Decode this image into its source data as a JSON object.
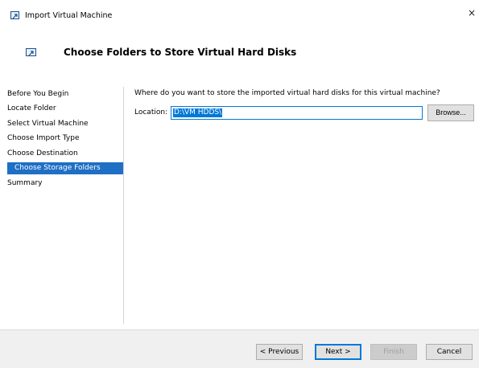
{
  "window": {
    "title": "Import Virtual Machine",
    "close_glyph": "×",
    "icon": "import-vm-icon"
  },
  "header": {
    "title": "Choose Folders to Store Virtual Hard Disks"
  },
  "nav": {
    "items": [
      {
        "label": "Before You Begin",
        "active": false
      },
      {
        "label": "Locate Folder",
        "active": false
      },
      {
        "label": "Select Virtual Machine",
        "active": false
      },
      {
        "label": "Choose Import Type",
        "active": false
      },
      {
        "label": "Choose Destination",
        "active": false
      },
      {
        "label": "Choose Storage Folders",
        "active": true
      },
      {
        "label": "Summary",
        "active": false
      }
    ]
  },
  "content": {
    "question": "Where do you want to store the imported virtual hard disks for this virtual machine?",
    "location_label": "Location:",
    "location_value": "D:\\VM HDDS\\",
    "browse_label": "Browse..."
  },
  "footer": {
    "previous_label": "< Previous",
    "next_label": "Next >",
    "finish_label": "Finish",
    "cancel_label": "Cancel"
  },
  "colors": {
    "accent": "#1f6fc5",
    "focus": "#0078d7"
  }
}
